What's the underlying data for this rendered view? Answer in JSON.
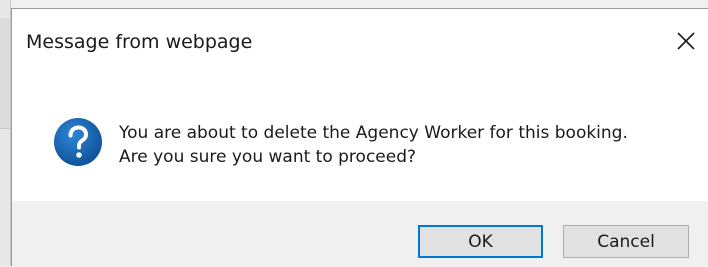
{
  "dialog": {
    "title": "Message from webpage",
    "close_icon": "close-icon",
    "icon": "question-icon",
    "message_lines": [
      "You are about to delete the Agency Worker for this booking.",
      "Are you sure you want to proceed?"
    ],
    "buttons": {
      "ok_label": "OK",
      "cancel_label": "Cancel"
    },
    "colors": {
      "accent": "#0078d7",
      "icon_blue": "#1c64ab",
      "button_bar": "#f0f0f0"
    }
  }
}
